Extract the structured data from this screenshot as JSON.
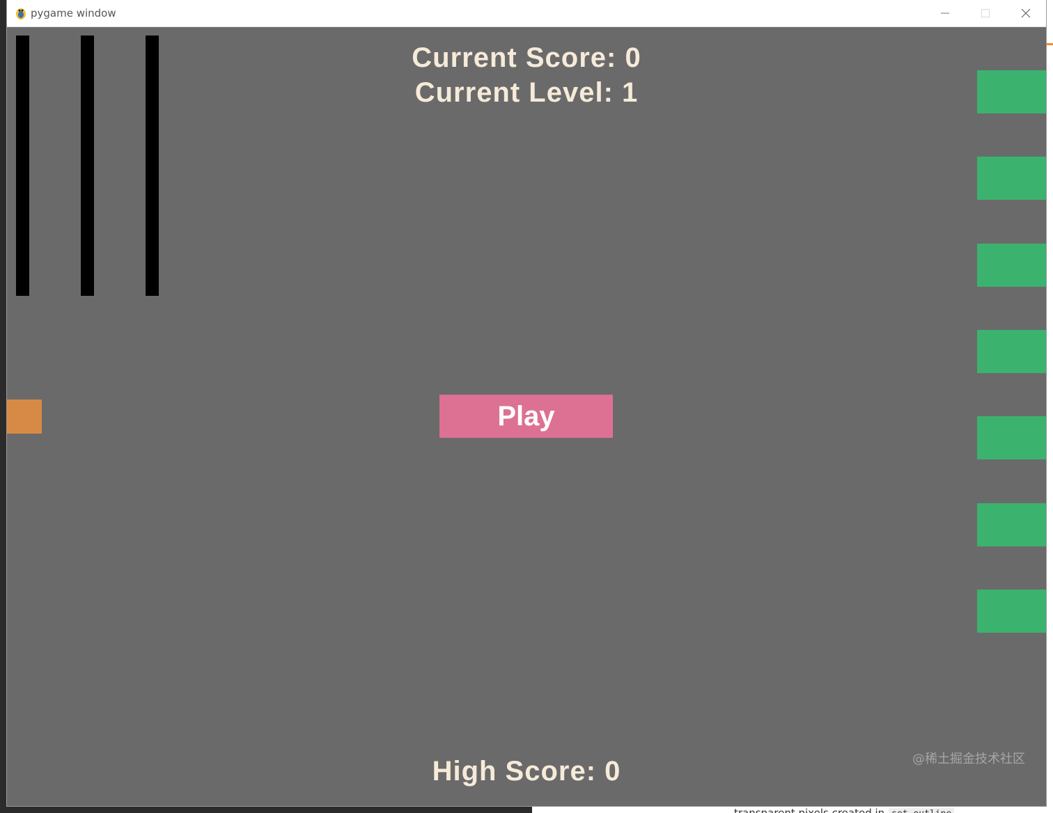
{
  "window": {
    "title": "pygame window",
    "minimize_icon": "minimize-icon",
    "maximize_icon": "maximize-icon",
    "close_icon": "close-icon",
    "app_icon": "pygame-snake-icon"
  },
  "game": {
    "current_score": "Current Score: 0",
    "current_level": "Current Level: 1",
    "play_label": "Play",
    "high_score": "High Score: 0",
    "colors": {
      "background": "#6a6a6a",
      "text": "#f6ead9",
      "play_button": "#dc7193",
      "player": "#d68a45",
      "targets": "#3bb36f",
      "bars": "#000000"
    }
  },
  "background_page": {
    "bottom_text": "transparent pixels created in",
    "bottom_code": "set_outline"
  },
  "watermark": "@稀土掘金技术社区"
}
